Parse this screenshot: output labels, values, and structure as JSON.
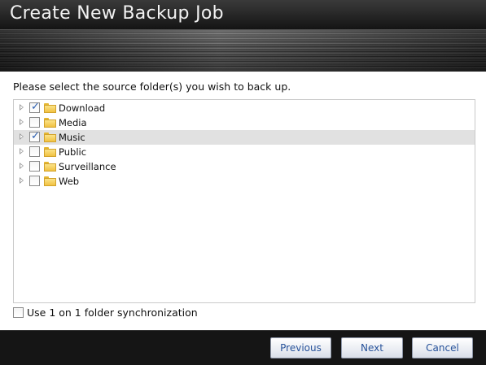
{
  "dialog": {
    "title": "Create New Backup Job"
  },
  "content": {
    "prompt": "Please select the source folder(s) you wish to back up.",
    "folders": [
      {
        "label": "Download",
        "checked": true,
        "selected": false
      },
      {
        "label": "Media",
        "checked": false,
        "selected": false
      },
      {
        "label": "Music",
        "checked": true,
        "selected": true
      },
      {
        "label": "Public",
        "checked": false,
        "selected": false
      },
      {
        "label": "Surveillance",
        "checked": false,
        "selected": false
      },
      {
        "label": "Web",
        "checked": false,
        "selected": false
      }
    ],
    "sync_option": {
      "label": "Use 1 on 1 folder synchronization",
      "checked": false
    }
  },
  "footer": {
    "previous_label": "Previous",
    "next_label": "Next",
    "cancel_label": "Cancel"
  },
  "colors": {
    "accent_text": "#27529a",
    "selected_row": "#e1e1e1",
    "check": "#2a5db0"
  },
  "icons": {
    "expander": "triangle-right-icon",
    "folder": "folder-icon",
    "checkbox": "checkbox-icon"
  }
}
